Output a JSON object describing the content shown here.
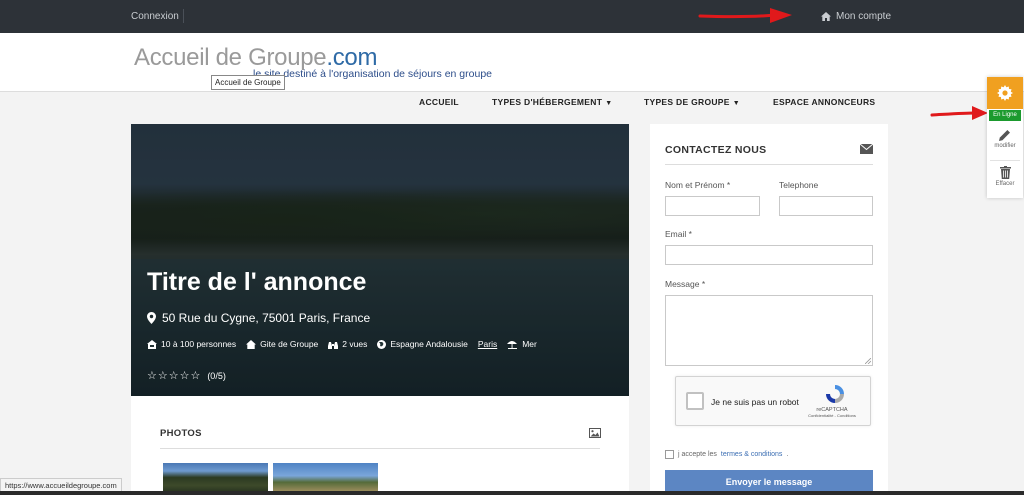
{
  "topbar": {
    "login_label": "Connexion",
    "account_label": "Mon compte"
  },
  "header": {
    "logo_main": "Accueil de Groupe",
    "logo_tld": ".com",
    "tagline": "le site destiné à l'organisation de séjours en groupe",
    "tooltip": "Accueil de Groupe"
  },
  "nav": {
    "items": [
      {
        "label": "ACCUEIL"
      },
      {
        "label": "TYPES D'HÉBERGEMENT"
      },
      {
        "label": "TYPES DE GROUPE"
      },
      {
        "label": "ESPACE ANNONCEURS"
      }
    ]
  },
  "hero": {
    "title": "Titre de l' annonce",
    "address": "50 Rue du Cygne, 75001 Paris, France",
    "capacity": "10 à 100 personnes",
    "type": "Gite de Groupe",
    "views": "2 vues",
    "region": "Espagne Andalousie",
    "city": "Paris",
    "environment": "Mer",
    "stars": "☆☆☆☆☆",
    "rating": "(0/5)"
  },
  "photos": {
    "title": "PHOTOS"
  },
  "contact": {
    "title": "CONTACTEZ NOUS",
    "name_label": "Nom et Prénom *",
    "phone_label": "Telephone",
    "email_label": "Email *",
    "message_label": "Message *",
    "recaptcha_text": "Je ne suis pas un robot",
    "recaptcha_brand": "reCAPTCHA",
    "recaptcha_links": "Confidentialité - Conditions",
    "terms_prefix": "j accepte les",
    "terms_link": "termes & conditions",
    "terms_suffix": ".",
    "send_label": "Envoyer le message"
  },
  "side_widget": {
    "online_label": "En Ligne",
    "edit_label": "modifier",
    "delete_label": "Effacer"
  },
  "status_bar": {
    "url": "https://www.accueildegroupe.com"
  },
  "colors": {
    "topbar_bg": "#2d3238",
    "accent_blue": "#2e6aa6",
    "button_blue": "#5c86c3",
    "gear_orange": "#f0a020",
    "online_green": "#1b9a2e",
    "arrow_red": "#e0191b"
  }
}
